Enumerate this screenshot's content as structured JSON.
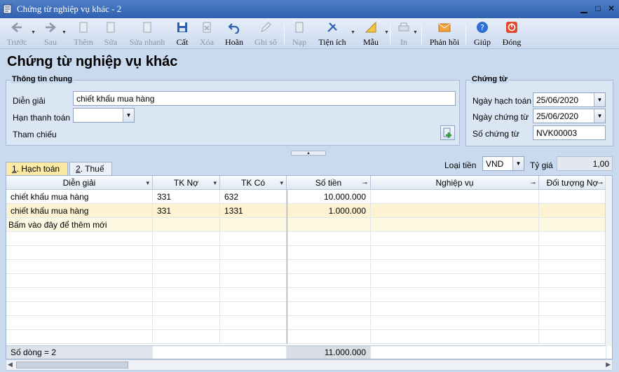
{
  "window": {
    "title": "Chứng từ nghiệp vụ khác - 2"
  },
  "toolbar": {
    "back": "Trước",
    "next": "Sau",
    "add": "Thêm",
    "edit": "Sửa",
    "quick_edit": "Sửa nhanh",
    "save": "Cất",
    "delete": "Xóa",
    "undo": "Hoãn",
    "post": "Ghi sổ",
    "load": "Nạp",
    "utility": "Tiện ích",
    "template": "Mẫu",
    "print": "In",
    "feedback": "Phản hồi",
    "help": "Giúp",
    "close": "Đóng"
  },
  "page": {
    "heading": "Chứng từ nghiệp vụ khác"
  },
  "general": {
    "title": "Thông tin chung",
    "description_label": "Diễn giải",
    "description_value": "chiết khấu mua hàng",
    "due_label": "Hạn thanh toán",
    "due_value": "",
    "reference_label": "Tham chiếu"
  },
  "voucher": {
    "title": "Chứng từ",
    "posting_date_label": "Ngày hạch toán",
    "posting_date_value": "25/06/2020",
    "voucher_date_label": "Ngày chứng từ",
    "voucher_date_value": "25/06/2020",
    "voucher_no_label": "Số chứng từ",
    "voucher_no_value": "NVK00003"
  },
  "tabs": [
    {
      "key": "1",
      "label": ". Hạch toán"
    },
    {
      "key": "2",
      "label": ". Thuế"
    }
  ],
  "currency": {
    "label": "Loại tiền",
    "value": "VND",
    "rate_label": "Tỷ giá",
    "rate_value": "1,00"
  },
  "grid": {
    "columns": [
      "Diễn giải",
      "TK Nợ",
      "TK Có",
      "Số tiền",
      "Nghiệp vụ",
      "Đối tượng Nợ"
    ],
    "rows": [
      [
        "chiết khấu mua hàng",
        "331",
        "632",
        "10.000.000",
        "",
        ""
      ],
      [
        "chiết khấu mua hàng",
        "331",
        "1331",
        "1.000.000",
        "",
        ""
      ]
    ],
    "new_row_hint": "Bấm vào đây để thêm mới",
    "footer_count": "Số dòng = 2",
    "footer_total": "11.000.000"
  },
  "colors": {
    "title_bar": "#2f61b0",
    "selected_row": "#fdf2d1",
    "active_tab": "#fde9a6"
  }
}
